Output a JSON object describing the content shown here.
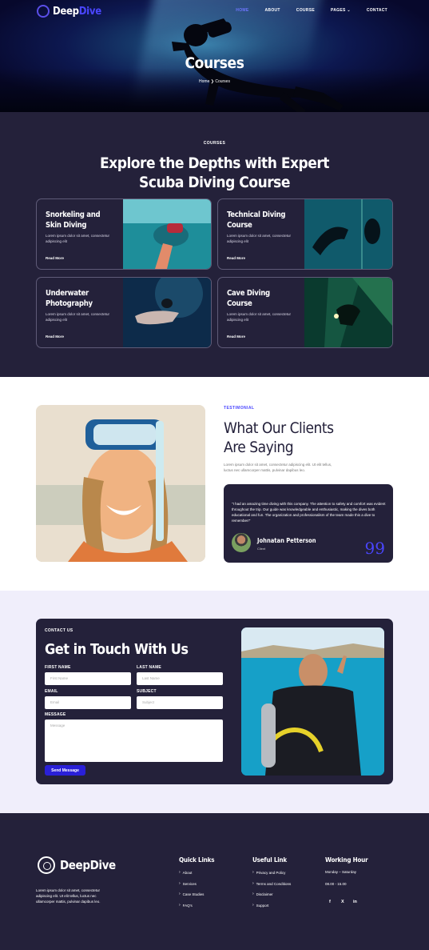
{
  "nav": {
    "brand_a": "Deep",
    "brand_b": "Dive",
    "items": [
      "HOME",
      "ABOUT",
      "COURSE",
      "PAGES",
      "CONTACT"
    ],
    "pages_chevron": "⌄"
  },
  "hero": {
    "title": "Courses",
    "crumb_home": "Home",
    "crumb_sep": "❯",
    "crumb_current": "Courses"
  },
  "courses": {
    "eyebrow": "COURSES",
    "title_line1": "Explore the Depths with Expert",
    "title_line2": "Scuba Diving Course",
    "cards": [
      {
        "title": "Snorkeling and Skin Diving",
        "desc": "Lorem ipsum dolor sit amet, consectetur adipiscing elit",
        "link": "Read More"
      },
      {
        "title": "Technical Diving Course",
        "desc": "Lorem ipsum dolor sit amet, consectetur adipiscing elit",
        "link": "Read More"
      },
      {
        "title": "Underwater Photography",
        "desc": "Lorem ipsum dolor sit amet, consectetur adipiscing elit",
        "link": "Read More"
      },
      {
        "title": "Cave Diving Course",
        "desc": "Lorem ipsum dolor sit amet, consectetur adipiscing elit",
        "link": "Read More"
      }
    ]
  },
  "testimonial": {
    "eyebrow": "TESTIMONIAL",
    "title_line1": "What Our Clients",
    "title_line2": "Are Saying",
    "desc": "Lorem ipsum dolor sit amet, consectetur adipiscing elit. Ut elit tellus, luctus nec ullamcorper mattis, pulvinar dapibus leo.",
    "quote": "\"I had an amazing time diving with this company. The attention to safety and comfort was evident throughout the trip. Our guide was knowledgeable and enthusiastic, making the dives both educational and fun. The organization and professionalism of the team made this a dive to remember!\"",
    "name": "Johnatan Petterson",
    "role": "Client",
    "quote_mark": "99"
  },
  "contact": {
    "eyebrow": "CONTACT US",
    "title": "Get in Touch With Us",
    "first_label": "FIRST NAME",
    "first_placeholder": "First Name",
    "last_label": "LAST NAME",
    "last_placeholder": "Last Name",
    "email_label": "EMAIL",
    "email_placeholder": "Email",
    "subject_label": "SUBJECT",
    "subject_placeholder": "Subject",
    "message_label": "MESSAGE",
    "message_placeholder": "Message",
    "send": "Send Message"
  },
  "footer": {
    "brand": "DeepDive",
    "about": "Lorem ipsum dolor sit amet, consectetur adipiscing elit. Ut elit tellus, luctus nec ullamcorper mattis, pulvinar dapibus leo.",
    "quick_title": "Quick Links",
    "quick_links": [
      "About",
      "Services",
      "Case Studies",
      "FAQ's"
    ],
    "useful_title": "Useful Link",
    "useful_links": [
      "Privacy and Policy",
      "Terms and Conditions",
      "Disclaimer",
      "Support"
    ],
    "hours_title": "Working Hour",
    "hours_days": "Monday – Saturday",
    "hours_time": "08.00 - 15.00",
    "social": [
      "f",
      "X",
      "in"
    ]
  },
  "colors": {
    "accent": "#4a46ff",
    "dark": "#24213a",
    "light_bg": "#f0eefb"
  }
}
